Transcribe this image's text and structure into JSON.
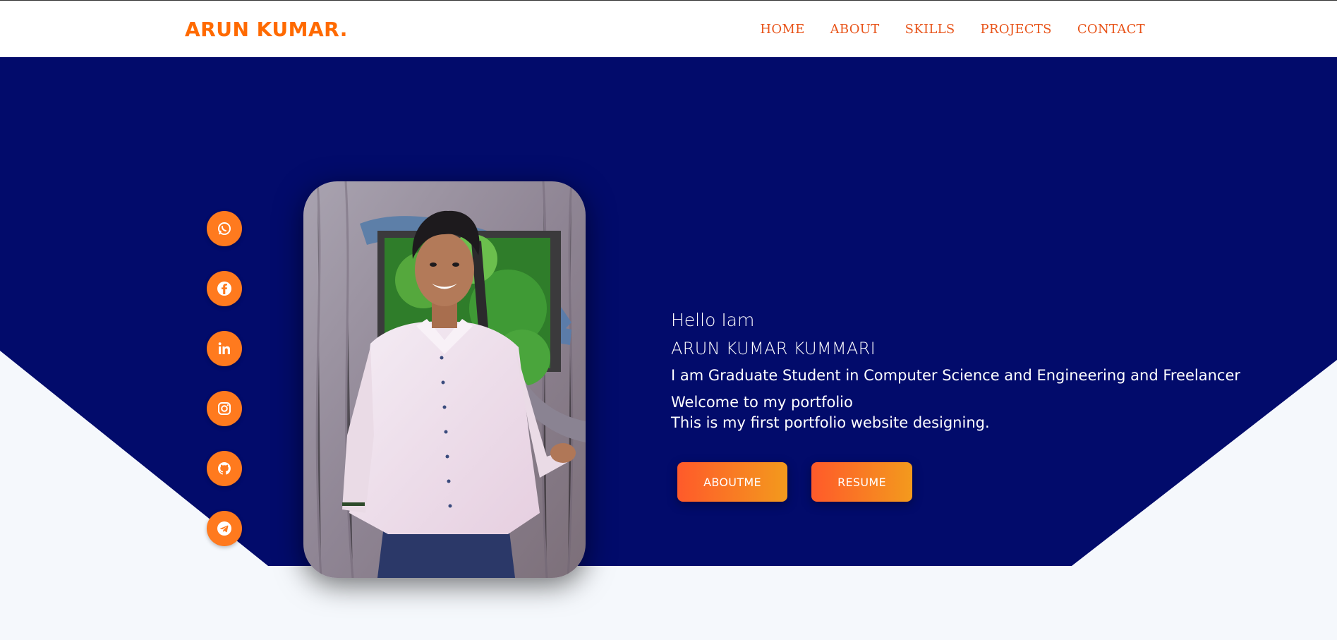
{
  "header": {
    "logo": "ARUN KUMAR.",
    "nav": [
      "HOME",
      "ABOUT",
      "SKILLS",
      "PROJECTS",
      "CONTACT"
    ]
  },
  "socials": [
    "whatsapp-icon",
    "facebook-icon",
    "linkedin-icon",
    "instagram-icon",
    "github-icon",
    "telegram-icon"
  ],
  "intro": {
    "hello": "Hello Iam",
    "name": "ARUN KUMAR KUMMARI",
    "tagline": "I am Graduate Student in Computer Science and Engineering and Freelancer",
    "welcome": "Welcome to my portfolio",
    "first_site": "This is my first portfolio website designing."
  },
  "buttons": {
    "about": "ABOUTME",
    "resume": "RESUME"
  },
  "colors": {
    "accent": "#ff6a00",
    "hero_bg": "#020b6b",
    "page_bg": "#f5f8fc"
  }
}
